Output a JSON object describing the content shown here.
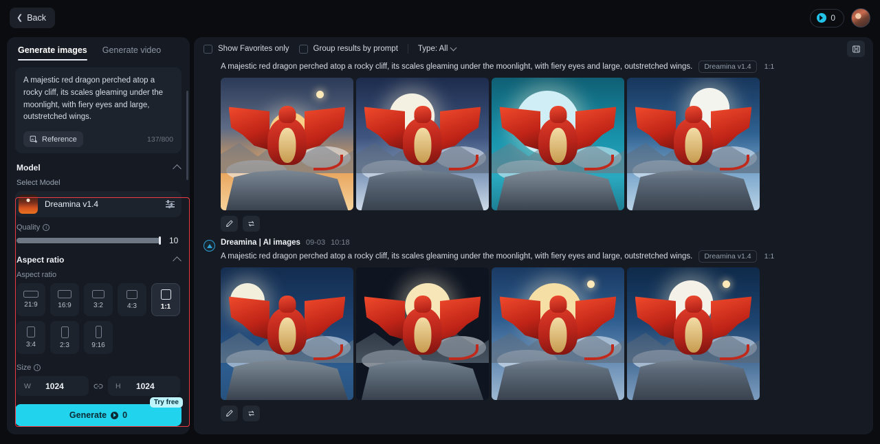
{
  "topbar": {
    "back_label": "Back",
    "credits_value": "0",
    "coin_icon": "coin-icon",
    "avatar_icon": "user-avatar"
  },
  "sidebar": {
    "tabs": [
      {
        "label": "Generate images",
        "active": true
      },
      {
        "label": "Generate video",
        "active": false
      }
    ],
    "prompt": {
      "text": "A majestic red dragon perched atop a rocky cliff, its scales gleaming under the moonlight, with fiery eyes and large, outstretched wings.",
      "reference_label": "Reference",
      "reference_icon": "add-image-icon",
      "counter": "137/800"
    },
    "model_section": {
      "title": "Model",
      "collapse_icon": "chevron-up-icon",
      "select_label": "Select Model",
      "model_name": "Dreamina v1.4",
      "settings_icon": "sliders-icon",
      "quality_label": "Quality",
      "quality_info_icon": "info-icon",
      "quality_value": "10"
    },
    "aspect_section": {
      "title": "Aspect ratio",
      "collapse_icon": "chevron-up-icon",
      "field_label": "Aspect ratio",
      "options": [
        {
          "label": "21:9",
          "w": 22,
          "h": 10,
          "selected": false
        },
        {
          "label": "16:9",
          "w": 20,
          "h": 12,
          "selected": false
        },
        {
          "label": "3:2",
          "w": 18,
          "h": 12,
          "selected": false
        },
        {
          "label": "4:3",
          "w": 16,
          "h": 13,
          "selected": false
        },
        {
          "label": "1:1",
          "w": 15,
          "h": 15,
          "selected": true
        },
        {
          "label": "3:4",
          "w": 12,
          "h": 16,
          "selected": false
        },
        {
          "label": "2:3",
          "w": 11,
          "h": 17,
          "selected": false
        },
        {
          "label": "9:16",
          "w": 9,
          "h": 18,
          "selected": false
        }
      ]
    },
    "size_section": {
      "label": "Size",
      "info_icon": "info-icon",
      "width_prefix": "W",
      "width_value": "1024",
      "link_icon": "link-icon",
      "height_prefix": "H",
      "height_value": "1024"
    },
    "generate": {
      "label": "Generate",
      "coin_icon": "coin-icon",
      "cost": "0",
      "badge": "Try free"
    },
    "highlight_color": "#ef3b41"
  },
  "content": {
    "toolbar": {
      "favorites_label": "Show Favorites only",
      "favorites_checked": false,
      "group_label": "Group results by prompt",
      "group_checked": false,
      "type_label": "Type: All",
      "type_chevron_icon": "chevron-down-icon",
      "folder_icon": "folder-icon"
    },
    "results": [
      {
        "has_header": false,
        "prompt": "A majestic red dragon perched atop a rocky cliff, its scales gleaming under the moonlight, with fiery eyes and large, outstretched wings.",
        "model_pill": "Dreamina v1.4",
        "ratio_pill": "1:1",
        "images": [
          {
            "alt": "red dragon on cliff at golden sunset with full moon"
          },
          {
            "alt": "red dragon on rocky peak under bright moon with snowy mountains"
          },
          {
            "alt": "red dragon with outstretched wings on teal moonlit background"
          },
          {
            "alt": "red dragon on cliff under full moon in blue cloudy sky"
          }
        ],
        "actions": [
          {
            "icon": "edit-pencil-icon",
            "name": "edit-button"
          },
          {
            "icon": "regenerate-icon",
            "name": "regenerate-button"
          }
        ]
      },
      {
        "has_header": true,
        "badge_icon": "dreamina-badge-icon",
        "source": "Dreamina | AI images",
        "date": "09-03",
        "time": "10:18",
        "prompt": "A majestic red dragon perched atop a rocky cliff, its scales gleaming under the moonlight, with fiery eyes and large, outstretched wings.",
        "model_pill": "Dreamina v1.4",
        "ratio_pill": "1:1",
        "images": [
          {
            "alt": "red dragon on stone stairs in blue moonlit mountain night"
          },
          {
            "alt": "red dragon roaring with wings spread under moon"
          },
          {
            "alt": "red dragon on rocky outcrop before large golden moon"
          },
          {
            "alt": "red dragon with antlers before white moon and clouds"
          }
        ],
        "actions": [
          {
            "icon": "edit-pencil-icon",
            "name": "edit-button"
          },
          {
            "icon": "regenerate-icon",
            "name": "regenerate-button"
          }
        ]
      }
    ]
  }
}
